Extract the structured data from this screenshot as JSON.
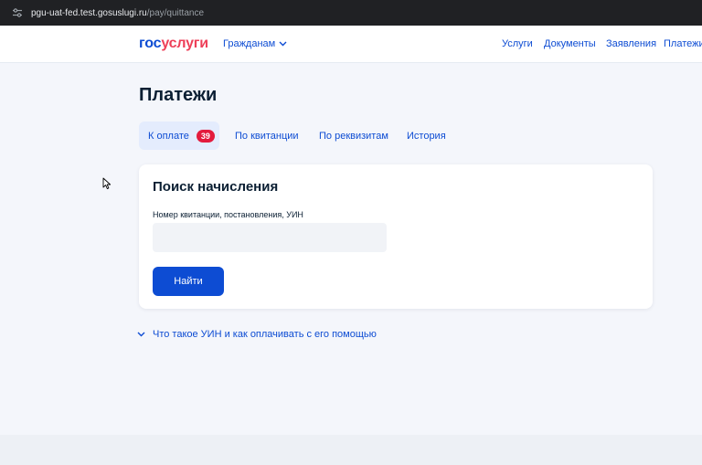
{
  "browser": {
    "url_host": "pgu-uat-fed.test.gosuslugi.ru",
    "url_path": "/pay/quittance"
  },
  "header": {
    "logo_part1": "гос",
    "logo_part2": "услуги",
    "citizens_label": "Гражданам",
    "nav": [
      "Услуги",
      "Документы",
      "Заявления",
      "Платежи"
    ]
  },
  "main": {
    "title": "Платежи",
    "tabs": [
      {
        "label": "К оплате",
        "badge": "39"
      },
      {
        "label": "По квитанции"
      },
      {
        "label": "По реквизитам"
      },
      {
        "label": "История"
      }
    ],
    "search": {
      "title": "Поиск начисления",
      "field_label": "Номер квитанции, постановления, УИН",
      "field_value": "",
      "button_label": "Найти"
    },
    "faq_label": "Что такое УИН и как оплачивать с его помощью"
  },
  "colors": {
    "accent": "#0d4cd3",
    "brand_red": "#ee3f58",
    "badge": "#e31b3d",
    "page_bg": "#f4f6fb"
  },
  "icons": [
    "site-info-icon",
    "chevron-down-icon",
    "cursor-icon"
  ]
}
